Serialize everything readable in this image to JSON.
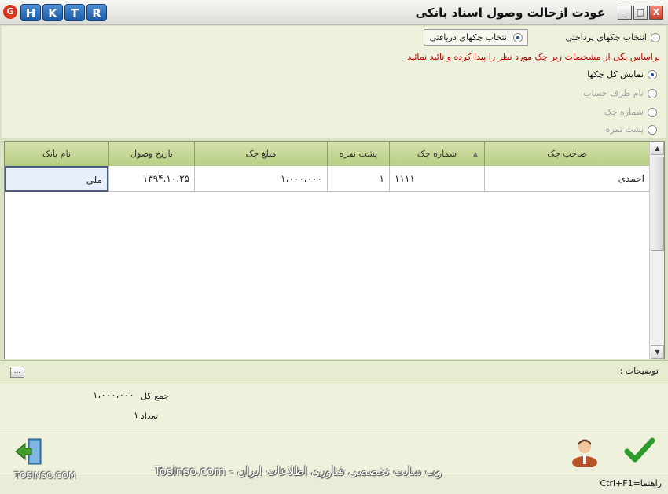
{
  "window": {
    "title": "عودت ازحالت وصول اسناد بانکی",
    "logo_letter": "G",
    "hktr": [
      "H",
      "K",
      "T",
      "R"
    ],
    "min_label": "_",
    "max_label": "□",
    "close_label": "X"
  },
  "check_type": {
    "paid_label": "انتخاب چکهای پرداختی",
    "received_label": "انتخاب چکهای دریافتی",
    "selected": "received"
  },
  "hint": "براساس یکی از مشخصات زیر چک مورد نظر را پیدا کرده و تائید نمائید",
  "filters": [
    {
      "label": "نمایش کل چکها",
      "selected": true,
      "enabled": true
    },
    {
      "label": "نام طرف حساب",
      "selected": false,
      "enabled": false
    },
    {
      "label": "شماره چک",
      "selected": false,
      "enabled": false
    },
    {
      "label": "پشت نمره",
      "selected": false,
      "enabled": false
    }
  ],
  "grid": {
    "columns": {
      "owner": "صاحب چک",
      "check_no": "شماره چک",
      "sort_marker": "▲",
      "back_no": "پشت نمره",
      "amount": "مبلغ چک",
      "receive_date": "تاریخ وصول",
      "bank": "نام بانک"
    },
    "rows": [
      {
        "owner": "احمدی",
        "check_no": "۱۱۱۱",
        "back_no": "۱",
        "amount": "۱،۰۰۰،۰۰۰",
        "receive_date": "۱۳۹۴.۱۰.۲۵",
        "bank": "ملی"
      }
    ]
  },
  "notes": {
    "label": "توضیحات :",
    "button": "..."
  },
  "totals": {
    "sum_label": "جمع کل",
    "sum_value": "۱،۰۰۰،۰۰۰",
    "count_label": "تعداد",
    "count_value": "۱"
  },
  "status": {
    "shortcut": "راهنما=Ctrl+F1",
    "watermark_left": "TOSINSO.COM",
    "watermark_center": "وب سایت تخصصی فناوری اطلاعات ایران - Tosinso.com"
  },
  "colors": {
    "accept": "#2e9b2e",
    "hint": "#bb0000",
    "header": "#c7d898"
  }
}
